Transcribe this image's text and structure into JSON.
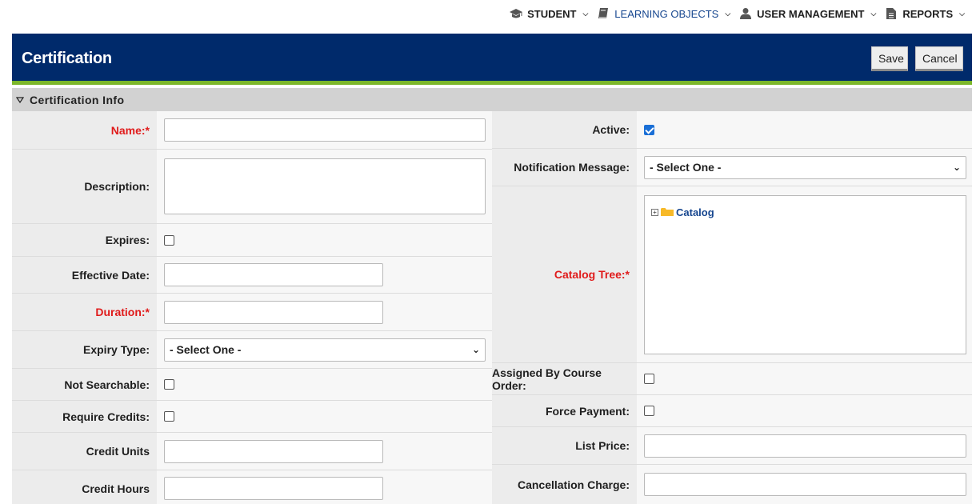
{
  "topnav": [
    {
      "label": "STUDENT",
      "icon": "graduation-cap-icon",
      "active": false
    },
    {
      "label": "LEARNING OBJECTS",
      "icon": "book-icon",
      "active": true
    },
    {
      "label": "USER MANAGEMENT",
      "icon": "user-icon",
      "active": false
    },
    {
      "label": "REPORTS",
      "icon": "document-icon",
      "active": false
    }
  ],
  "header": {
    "title": "Certification",
    "save_label": "Save",
    "cancel_label": "Cancel"
  },
  "section": {
    "title": "Certification Info"
  },
  "left": {
    "name": {
      "label": "Name:*",
      "value": ""
    },
    "description": {
      "label": "Description:",
      "value": ""
    },
    "expires": {
      "label": "Expires:",
      "checked": false
    },
    "effective_date": {
      "label": "Effective Date:",
      "value": ""
    },
    "duration": {
      "label": "Duration:*",
      "value": ""
    },
    "expiry_type": {
      "label": "Expiry Type:",
      "value": "- Select One -"
    },
    "not_searchable": {
      "label": "Not Searchable:",
      "checked": false
    },
    "require_credits": {
      "label": "Require Credits:",
      "checked": false
    },
    "credit_units": {
      "label": "Credit Units",
      "value": ""
    },
    "credit_hours": {
      "label": "Credit Hours",
      "value": ""
    }
  },
  "right": {
    "active": {
      "label": "Active:",
      "checked": true
    },
    "notification_message": {
      "label": "Notification Message:",
      "value": "- Select One -"
    },
    "catalog_tree": {
      "label": "Catalog Tree:*",
      "root": "Catalog"
    },
    "assigned_by_course_order": {
      "label": "Assigned By Course Order:",
      "checked": false
    },
    "force_payment": {
      "label": "Force Payment:",
      "checked": false
    },
    "list_price": {
      "label": "List Price:",
      "value": ""
    },
    "cancellation_charge": {
      "label": "Cancellation Charge:",
      "value": ""
    }
  },
  "colors": {
    "header_bg": "#002a6b",
    "accent_green": "#7cb72a",
    "required_red": "#e01b1b",
    "link_blue": "#16468f",
    "checkbox_blue": "#1a6fd6"
  }
}
